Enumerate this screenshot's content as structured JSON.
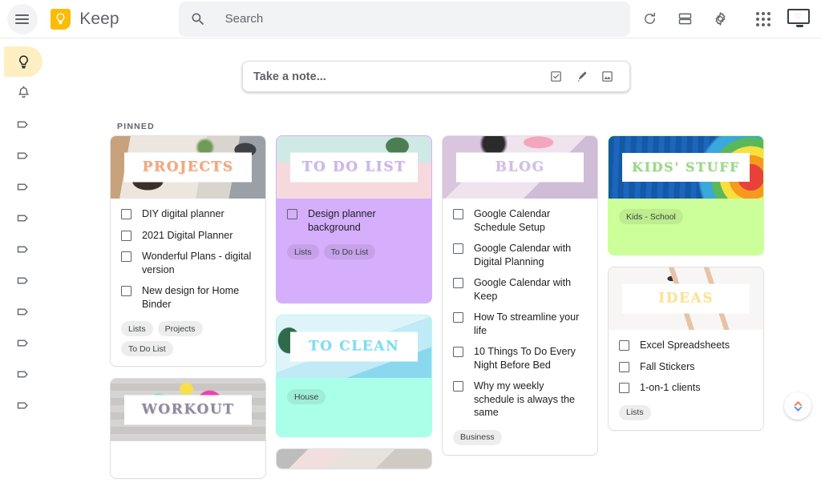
{
  "app": {
    "name": "Keep",
    "menu_icon": "hamburger-menu-icon",
    "logo_icon": "keep-lightbulb-logo"
  },
  "search": {
    "placeholder": "Search",
    "value": "",
    "icon": "search-icon"
  },
  "topbar_actions": [
    {
      "name": "refresh-button",
      "icon": "refresh-icon"
    },
    {
      "name": "list-view-button",
      "icon": "list-view-icon"
    },
    {
      "name": "settings-button",
      "icon": "gear-icon"
    },
    {
      "name": "google-apps-button",
      "icon": "apps-grid-icon"
    },
    {
      "name": "account-avatar",
      "icon": "monitor-avatar-icon"
    }
  ],
  "sidebar": {
    "items": [
      {
        "name": "sidebar-item-notes",
        "icon": "lightbulb-icon",
        "active": true
      },
      {
        "name": "sidebar-item-reminders",
        "icon": "bell-icon",
        "active": false
      },
      {
        "name": "sidebar-item-label-1",
        "icon": "label-tag-icon",
        "active": false
      },
      {
        "name": "sidebar-item-label-2",
        "icon": "label-tag-icon",
        "active": false
      },
      {
        "name": "sidebar-item-label-3",
        "icon": "label-tag-icon",
        "active": false
      },
      {
        "name": "sidebar-item-label-4",
        "icon": "label-tag-icon",
        "active": false
      },
      {
        "name": "sidebar-item-label-5",
        "icon": "label-tag-icon",
        "active": false
      },
      {
        "name": "sidebar-item-label-6",
        "icon": "label-tag-icon",
        "active": false
      },
      {
        "name": "sidebar-item-label-7",
        "icon": "label-tag-icon",
        "active": false
      },
      {
        "name": "sidebar-item-label-8",
        "icon": "label-tag-icon",
        "active": false
      },
      {
        "name": "sidebar-item-label-9",
        "icon": "label-tag-icon",
        "active": false
      },
      {
        "name": "sidebar-item-label-10",
        "icon": "label-tag-icon",
        "active": false
      }
    ]
  },
  "take_note": {
    "placeholder": "Take a note...",
    "value": "",
    "actions": [
      {
        "name": "new-list-button",
        "icon": "checkbox-list-icon"
      },
      {
        "name": "new-drawing-button",
        "icon": "brush-icon"
      },
      {
        "name": "new-image-note-button",
        "icon": "image-icon"
      }
    ]
  },
  "board": {
    "section_label": "PINNED",
    "columns": [
      {
        "cards": [
          {
            "title": "PROJECTS",
            "title_color": "#f0a882",
            "body_bg": "#ffffff",
            "photo": "photo-projects",
            "items": [
              "DIY digital planner",
              "2021 Digital Planner",
              "Wonderful Plans - digital version",
              "New design for Home Binder"
            ],
            "tags": [
              "Lists",
              "Projects",
              "To Do List"
            ]
          },
          {
            "title": "WORKOUT",
            "title_color": "#8f8a9c",
            "body_bg": "#ffffff",
            "photo": "photo-workout",
            "items": [],
            "tags": []
          }
        ]
      },
      {
        "cards": [
          {
            "title": "TO DO LIST",
            "title_color": "#cbb6e8",
            "body_bg": "#d5aefc",
            "photo": "photo-todo",
            "items": [
              "Design planner background"
            ],
            "tags": [
              "Lists",
              "To Do List"
            ]
          },
          {
            "title": "TO CLEAN",
            "title_color": "#7fdcef",
            "body_bg": "#aaffe8",
            "photo": "photo-clean",
            "items": [],
            "tags": [
              "House"
            ]
          },
          {
            "title": "",
            "title_color": "#999999",
            "body_bg": "#ffffff",
            "photo": "photo-extra",
            "items": [],
            "tags": []
          }
        ]
      },
      {
        "cards": [
          {
            "title": "BLOG",
            "title_color": "#cfc0e2",
            "body_bg": "#ffffff",
            "photo": "photo-blog",
            "items": [
              "Google Calendar Schedule Setup",
              "Google Calendar with Digital Planning",
              "Google Calendar with Keep",
              "How To streamline your life",
              "10 Things To Do Every Night Before Bed",
              "Why my weekly schedule is always the same"
            ],
            "tags": [
              "Business"
            ]
          }
        ]
      },
      {
        "cards": [
          {
            "title": "KIDS' STUFF",
            "title_color": "#9bd68a",
            "body_bg": "#ccff99",
            "photo": "photo-kids",
            "items": [],
            "tags": [
              "Kids - School"
            ]
          },
          {
            "title": "IDEAS",
            "title_color": "#fae29a",
            "body_bg": "#ffffff",
            "photo": "photo-ideas",
            "items": [
              "Excel Spreadsheets",
              "Fall Stickers",
              "1-on-1 clients"
            ],
            "tags": [
              "Lists"
            ]
          }
        ]
      }
    ]
  },
  "assistant": {
    "name": "assistant-fab",
    "icon": "google-assistant-icon"
  },
  "colors": {
    "accent_yellow": "#fbbc04",
    "active_pill": "#feefc3",
    "text_primary": "#202124",
    "text_secondary": "#5f6368",
    "card_border": "#e0e0e0",
    "search_bg": "#f1f3f4"
  }
}
